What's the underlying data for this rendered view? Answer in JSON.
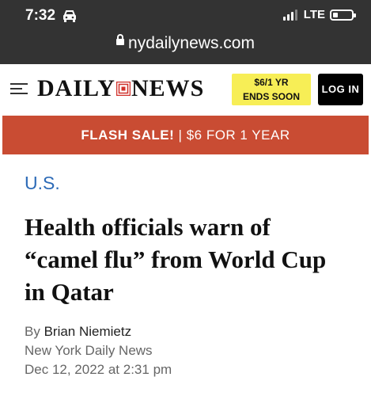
{
  "status_bar": {
    "time": "7:32",
    "network": "LTE"
  },
  "browser": {
    "url": "nydailynews.com"
  },
  "header": {
    "logo_left": "DAILY",
    "logo_right": "NEWS",
    "promo_line1": "$6/1 YR",
    "promo_line2": "ENDS SOON",
    "login_label": "LOG IN"
  },
  "flash_sale": {
    "label": "FLASH SALE!",
    "separator": "|",
    "offer": "$6 FOR 1 YEAR"
  },
  "article": {
    "section": "U.S.",
    "headline": "Health officials warn of “camel flu” from World Cup in Qatar",
    "byline_prefix": "By",
    "author": "Brian Niemietz",
    "publication": "New York Daily News",
    "date": "Dec 12, 2022 at 2:31 pm"
  },
  "colors": {
    "accent_flash": "#c94c33",
    "section_link": "#2d6bb7",
    "promo_bg": "#f7ee56",
    "topbar": "#333333"
  }
}
